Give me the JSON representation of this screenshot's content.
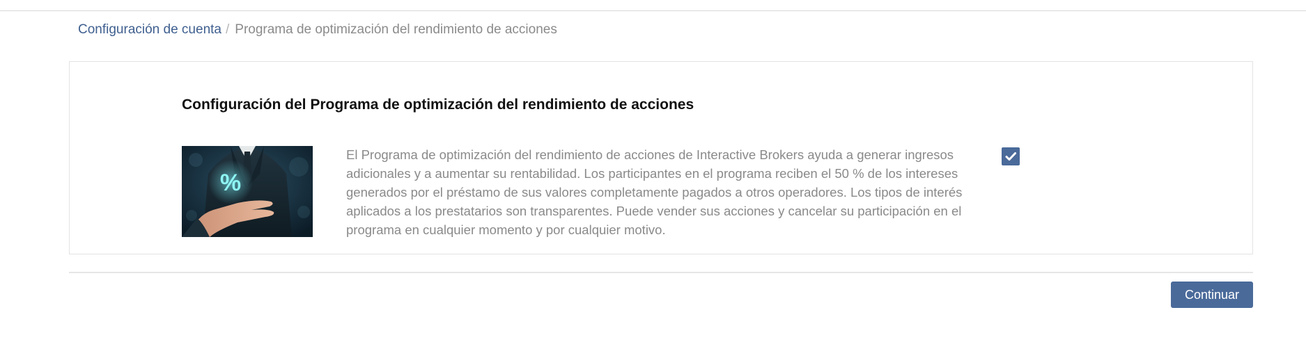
{
  "breadcrumb": {
    "parent": "Configuración de cuenta",
    "separator": "/",
    "current": "Programa de optimización del rendimiento de acciones"
  },
  "card": {
    "title": "Configuración del Programa de optimización del rendimiento de acciones",
    "image_text": "%",
    "image_icon": "hand-holding-percent-image",
    "description": "El Programa de optimización del rendimiento de acciones de Interactive Brokers ayuda a generar ingresos adicionales y a aumentar su rentabilidad. Los participantes en el programa reciben el 50 % de los intereses generados por el préstamo de sus valores completamente pagados a otros operadores. Los tipos de interés aplicados a los prestatarios son transparentes. Puede vender sus acciones y cancelar su participación en el programa en cualquier momento y por cualquier motivo.",
    "checkbox": {
      "checked": true,
      "icon": "checkmark-icon"
    }
  },
  "footer": {
    "continue_label": "Continuar"
  },
  "colors": {
    "accent": "#4a6a9a",
    "link": "#3f5f8f",
    "muted_text": "#8a8a8a"
  }
}
